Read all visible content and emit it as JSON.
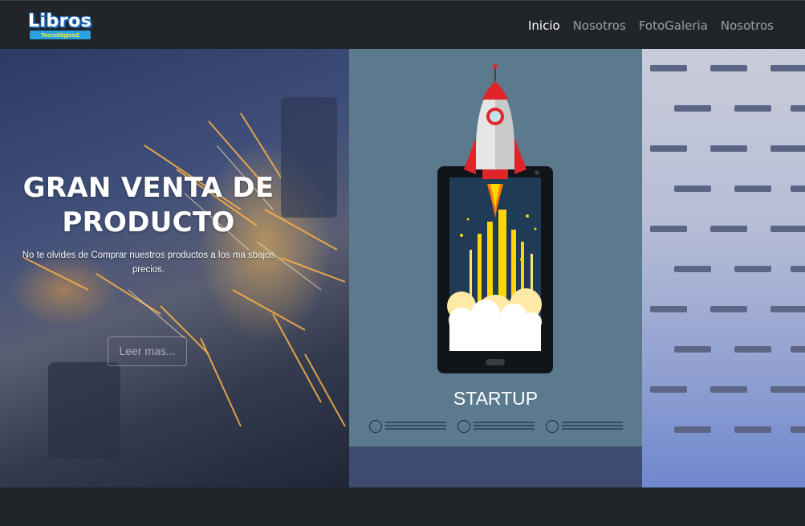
{
  "brand": {
    "logo_word": "Libros",
    "logo_sub": "TecnológicoZ"
  },
  "nav": {
    "items": [
      {
        "label": "Inicio",
        "active": true
      },
      {
        "label": "Nosotros",
        "active": false
      },
      {
        "label": "FotoGaleria",
        "active": false
      },
      {
        "label": "Nosotros",
        "active": false
      }
    ]
  },
  "hero": {
    "title": "GRAN VENTA DE PRODUCTO",
    "text": "No te olvides de Comprar nuestros productos a los ma sbajos precios.",
    "button_label": "Leer mas..."
  },
  "card": {
    "label": "STARTUP",
    "icons": [
      "chart-icon",
      "dollar-icon",
      "mail-icon"
    ],
    "colors": {
      "background": "#5c7a8e",
      "rocket_red": "#e0242a",
      "flame_yellow": "#ffd600"
    }
  }
}
